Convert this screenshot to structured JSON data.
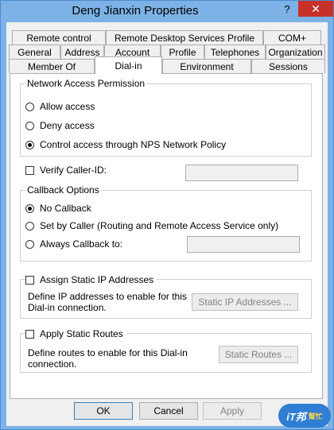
{
  "window": {
    "title": "Deng Jianxin Properties",
    "help_glyph": "?",
    "close_glyph": "✕"
  },
  "tabs": {
    "row1": [
      "Remote control",
      "Remote Desktop Services Profile",
      "COM+"
    ],
    "row2": [
      "General",
      "Address",
      "Account",
      "Profile",
      "Telephones",
      "Organization"
    ],
    "row3": [
      "Member Of",
      "Dial-in",
      "Environment",
      "Sessions"
    ],
    "active": "Dial-in"
  },
  "network_access": {
    "label": "Network Access Permission",
    "options": [
      "Allow access",
      "Deny access",
      "Control access through NPS Network Policy"
    ],
    "selected": "Control access through NPS Network Policy"
  },
  "verify_caller_id": {
    "label": "Verify Caller-ID:",
    "checked": false,
    "value": ""
  },
  "callback": {
    "label": "Callback Options",
    "options": [
      "No Callback",
      "Set by Caller (Routing and Remote Access Service only)",
      "Always Callback to:"
    ],
    "selected": "No Callback",
    "number": ""
  },
  "static_ip": {
    "label": "Assign Static IP Addresses",
    "checked": false,
    "description_line1": "Define IP addresses to enable for this",
    "description_line2": "Dial-in connection.",
    "button": "Static IP Addresses ..."
  },
  "static_routes": {
    "label": "Apply Static Routes",
    "checked": false,
    "description_line1": "Define routes to enable for this Dial-in",
    "description_line2": "connection.",
    "button": "Static Routes ..."
  },
  "footer": {
    "ok": "OK",
    "cancel": "Cancel",
    "apply": "Apply"
  },
  "watermark": {
    "main": "iT邦",
    "sub": "幫忙"
  },
  "colors": {
    "titlebar": "#7db2e6",
    "close_button": "#c7302b",
    "dialog_bg": "#f0f0f0",
    "panel_bg": "#ffffff"
  }
}
